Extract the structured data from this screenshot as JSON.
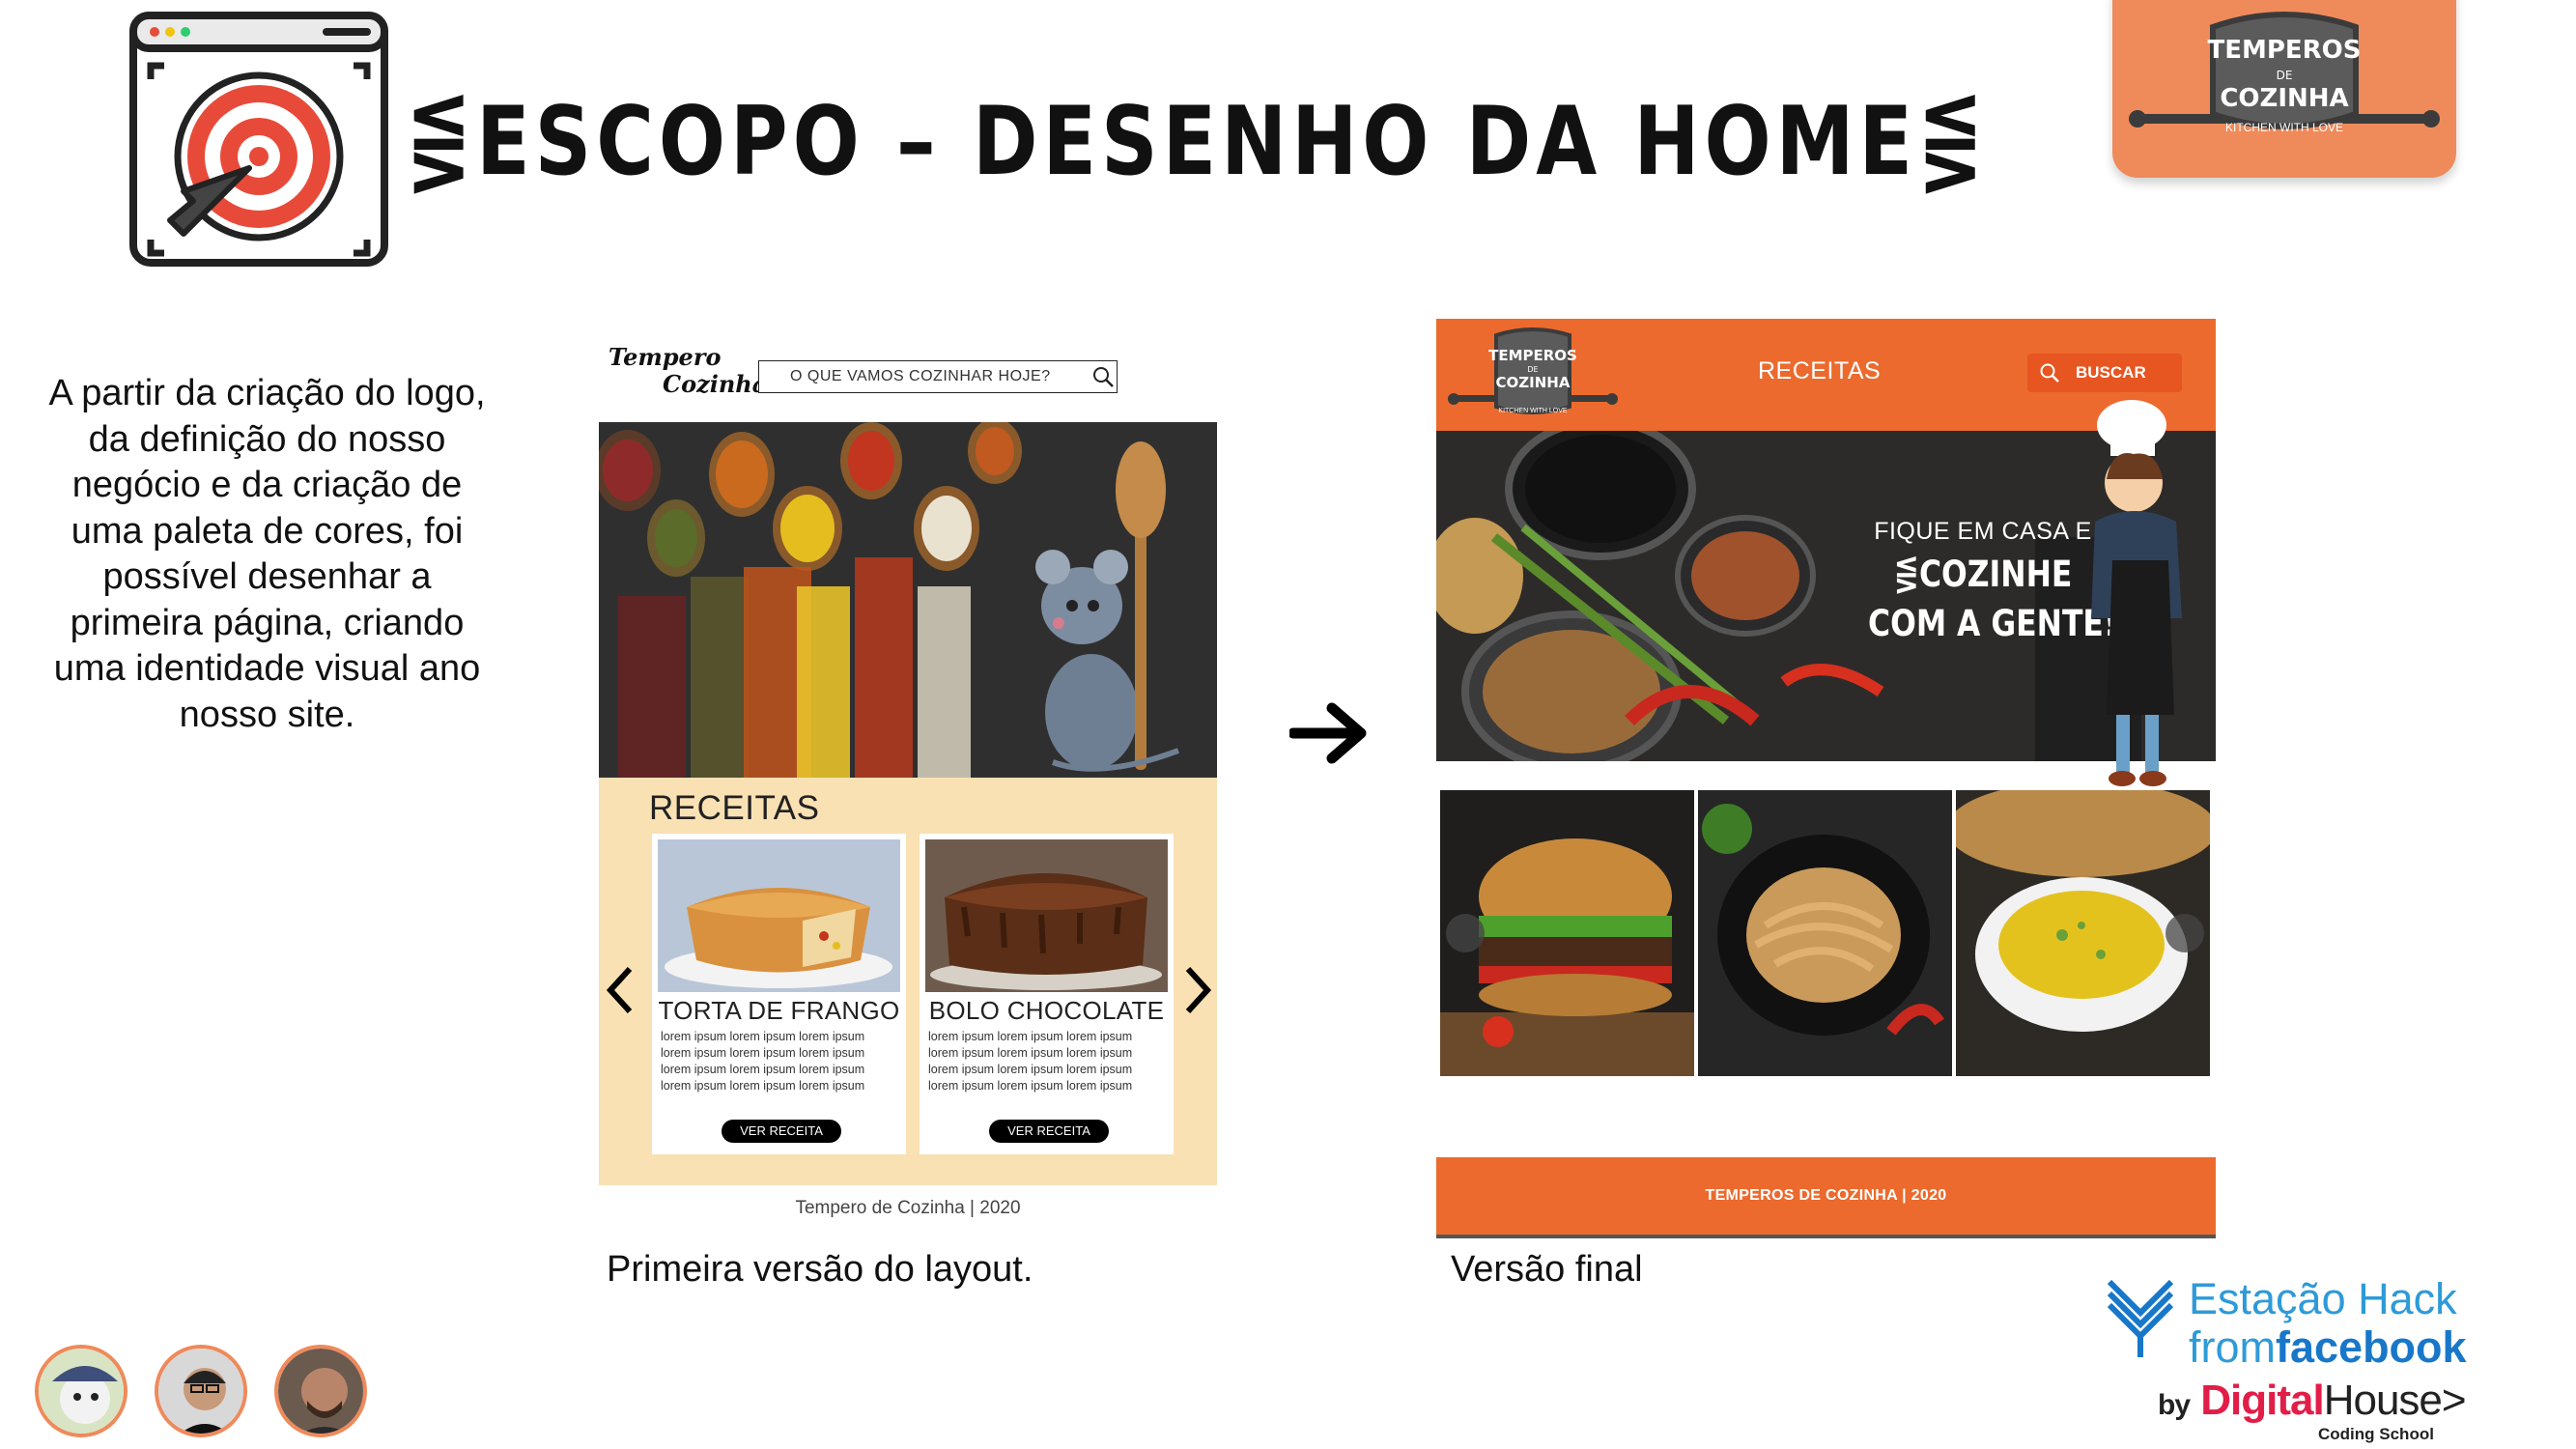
{
  "slide": {
    "title": "⋚ESCOPO – DESENHO DA HOME⋚",
    "description": "A partir da criação do logo, da definição do nosso negócio e da criação de uma paleta de cores, foi possível desenhar a primeira página, criando uma identidade visual ano nosso site.",
    "caption_first": "Primeira versão do layout.",
    "caption_final": "Versão final",
    "icons": [
      "browser-target-icon",
      "arrow-right-icon"
    ]
  },
  "brand_logo": {
    "line1": "TEMPEROS",
    "line2": "DE",
    "line3": "COZINHA",
    "tagline": "KITCHEN WITH LOVE",
    "badge_color": "#ef8a5b"
  },
  "first_layout": {
    "logo_line1": "Tempero",
    "logo_line2": "Cozinha",
    "search_placeholder": "O QUE VAMOS COZINHAR HOJE?",
    "section_title": "RECEITAS",
    "cards": [
      {
        "title": "TORTA DE FRANGO",
        "text": "lorem ipsum lorem ipsum lorem ipsum\nlorem ipsum lorem ipsum lorem ipsum\nlorem ipsum lorem ipsum lorem ipsum\nlorem ipsum lorem ipsum lorem ipsum",
        "button": "VER RECEITA"
      },
      {
        "title": "BOLO CHOCOLATE",
        "text": "lorem ipsum lorem ipsum lorem ipsum\nlorem ipsum lorem ipsum lorem ipsum\nlorem ipsum lorem ipsum lorem ipsum\nlorem ipsum lorem ipsum lorem ipsum",
        "button": "VER RECEITA"
      }
    ],
    "footer": "Tempero de Cozinha | 2020",
    "panel_color": "#f9e1b4"
  },
  "final_layout": {
    "logo_line1": "TEMPEROS",
    "logo_line2": "DE",
    "logo_line3": "COZINHA",
    "logo_tagline": "KITCHEN WITH LOVE",
    "nav_label": "RECEITAS",
    "search_label": "BUSCAR",
    "hero_line1": "FIQUE EM CASA E",
    "hero_line2": "⋚COZINHE",
    "hero_line3": "COM A GENTE!⋚",
    "footer": "TEMPEROS DE COZINHA | 2020",
    "accent_color": "#ec6a2d"
  },
  "sponsor": {
    "line1": "Estação Hack",
    "line2_prefix": "from",
    "line2_brand": "facebook",
    "line3_by": "by",
    "line3_brand_a": "Digital",
    "line3_brand_b": "House",
    "line3_suffix": ">",
    "line4": "Coding School"
  }
}
